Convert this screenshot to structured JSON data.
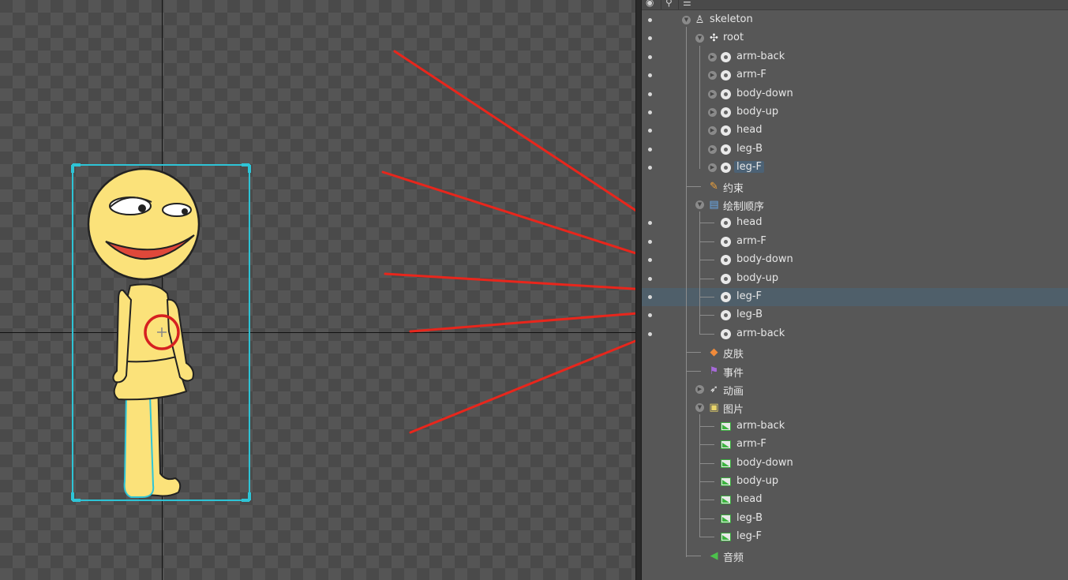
{
  "panel": {
    "header_icons": [
      "eye-icon",
      "bone-link-icon",
      "tree-list-icon"
    ]
  },
  "tree": {
    "skeleton": "skeleton",
    "root": "root",
    "bones": [
      "arm-back",
      "arm-F",
      "body-down",
      "body-up",
      "head",
      "leg-B",
      "leg-F"
    ],
    "constraints": "约束",
    "draw_order": "绘制顺序",
    "draw_order_items": [
      "head",
      "arm-F",
      "body-down",
      "body-up",
      "leg-F",
      "leg-B",
      "arm-back"
    ],
    "skins": "皮肤",
    "events": "事件",
    "animations": "动画",
    "images": "图片",
    "image_items": [
      "arm-back",
      "arm-F",
      "body-down",
      "body-up",
      "head",
      "leg-B",
      "leg-F"
    ],
    "audio": "音频"
  },
  "state": {
    "selected_draw_order_item": "leg-F",
    "highlighted_bone": "leg-F"
  },
  "colors": {
    "selection": "#4f5f6a",
    "bounding_box": "#2ec4d6",
    "arrow": "#e8261c",
    "pivot_circle": "#d62020",
    "character_fill": "#fbe27a",
    "mouth": "#e0483a"
  }
}
